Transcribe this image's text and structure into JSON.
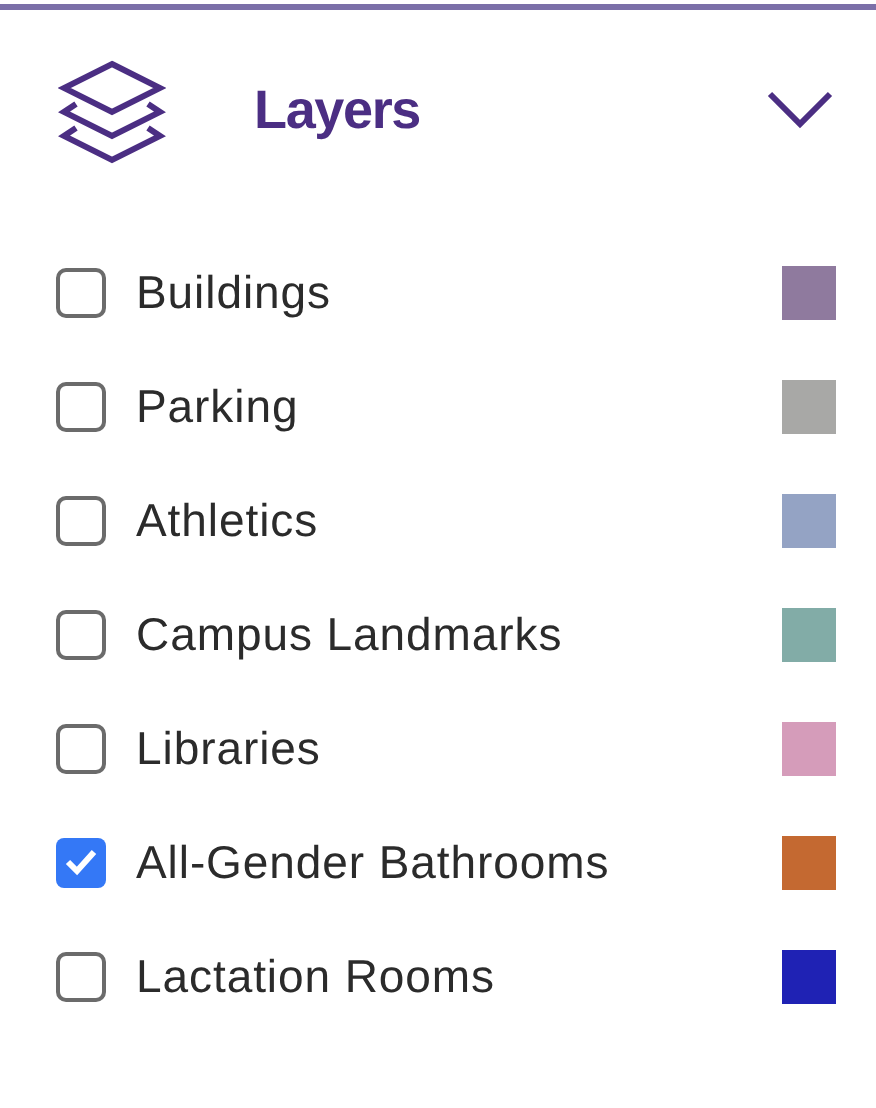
{
  "panel": {
    "title": "Layers"
  },
  "layers": [
    {
      "label": "Buildings",
      "checked": false,
      "color": "#8f7a9e"
    },
    {
      "label": "Parking",
      "checked": false,
      "color": "#a8a8a6"
    },
    {
      "label": "Athletics",
      "checked": false,
      "color": "#94a3c4"
    },
    {
      "label": "Campus Landmarks",
      "checked": false,
      "color": "#82aca7"
    },
    {
      "label": "Libraries",
      "checked": false,
      "color": "#d59cba"
    },
    {
      "label": "All-Gender Bathrooms",
      "checked": true,
      "color": "#c46931"
    },
    {
      "label": "Lactation Rooms",
      "checked": false,
      "color": "#1f22b4"
    }
  ]
}
